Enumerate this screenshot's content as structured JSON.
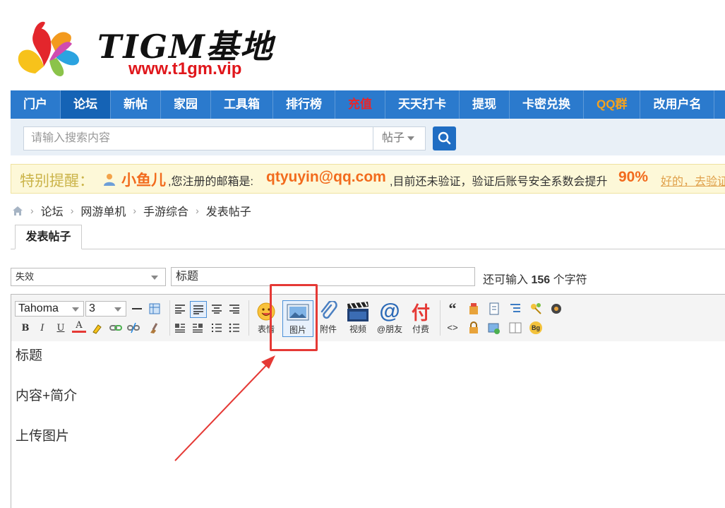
{
  "logo": {
    "text": "TIGM基地",
    "url": "www.t1gm.vip"
  },
  "nav": {
    "items": [
      {
        "label": "门户",
        "style": "normal"
      },
      {
        "label": "论坛",
        "style": "active"
      },
      {
        "label": "新帖",
        "style": "normal"
      },
      {
        "label": "家园",
        "style": "normal"
      },
      {
        "label": "工具箱",
        "style": "normal"
      },
      {
        "label": "排行榜",
        "style": "normal"
      },
      {
        "label": "充值",
        "style": "red"
      },
      {
        "label": "天天打卡",
        "style": "normal"
      },
      {
        "label": "提现",
        "style": "normal"
      },
      {
        "label": "卡密兑换",
        "style": "normal"
      },
      {
        "label": "QQ群",
        "style": "orange"
      },
      {
        "label": "改用户名",
        "style": "normal"
      }
    ]
  },
  "search": {
    "placeholder": "请输入搜索内容",
    "scope": "帖子"
  },
  "notice": {
    "title": "特别提醒：",
    "user": "小鱼儿",
    "text1": ",您注册的邮箱是:",
    "email": "qtyuyin@qq.com",
    "text2": ",目前还未验证，验证后账号安全系数会提升",
    "percent": "90%",
    "link": "好的，去验证"
  },
  "breadcrumb": {
    "items": [
      "论坛",
      "网游单机",
      "手游综合",
      "发表帖子"
    ]
  },
  "tab": {
    "label": "发表帖子"
  },
  "form": {
    "type_value": "失效",
    "title_value": "标题",
    "hint_prefix": "还可输入",
    "hint_count": "156",
    "hint_suffix": "个字符"
  },
  "toolbar": {
    "font_name": "Tahoma",
    "font_size": "3",
    "buttons": {
      "emoji": "表情",
      "image": "图片",
      "attach": "附件",
      "video": "视频",
      "mention": "@朋友",
      "pay": "付费"
    },
    "bold": "B",
    "italic": "I",
    "underline": "U",
    "color_a": "A",
    "pay_glyph": "付",
    "at_glyph": "@",
    "quote_glyph": "“",
    "code_glyph": "<>",
    "bg_glyph": "Bg"
  },
  "editor": {
    "lines": [
      "标题",
      "内容+简介",
      "上传图片"
    ]
  },
  "colors": {
    "nav_bg": "#2b7acd",
    "nav_active": "#1563b5",
    "accent_orange": "#f26b1d",
    "annotation_red": "#e53935"
  }
}
